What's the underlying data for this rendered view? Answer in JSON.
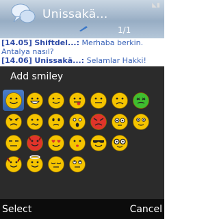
{
  "header": {
    "title": "Unissakä...",
    "pager": "1/1",
    "app_icon": "chat-bubbles-icon",
    "status_icon": "signal-icon"
  },
  "chat": {
    "messages": [
      {
        "time": "[14.05]",
        "nick": "Shiftdel...:",
        "text": "Merhaba berkin. Antalya nasıl?"
      },
      {
        "time": "[14.06]",
        "nick": "Unissakä...:",
        "text": "Selamlar Hakki!"
      }
    ]
  },
  "dialog": {
    "title": "Add smiley",
    "smileys": [
      "smile",
      "grin",
      "wink",
      "tongue",
      "neutral",
      "sad",
      "sick",
      "angry-frown",
      "confused",
      "frown",
      "surprised",
      "red-angry",
      "big-eyes",
      "worried",
      "annoyed",
      "devil-red",
      "heart-eyes",
      "kiss",
      "cool",
      "nerd-glasses",
      "",
      "devil",
      "angel",
      "sleepy",
      "rolling-eyes",
      "",
      "",
      ""
    ]
  },
  "softkeys": {
    "left": "Select",
    "right": "Cancel"
  },
  "colors": {
    "header": "#97adc4",
    "dialog": "#222222",
    "selection": "#3b6db5",
    "face": "#f5c400"
  }
}
